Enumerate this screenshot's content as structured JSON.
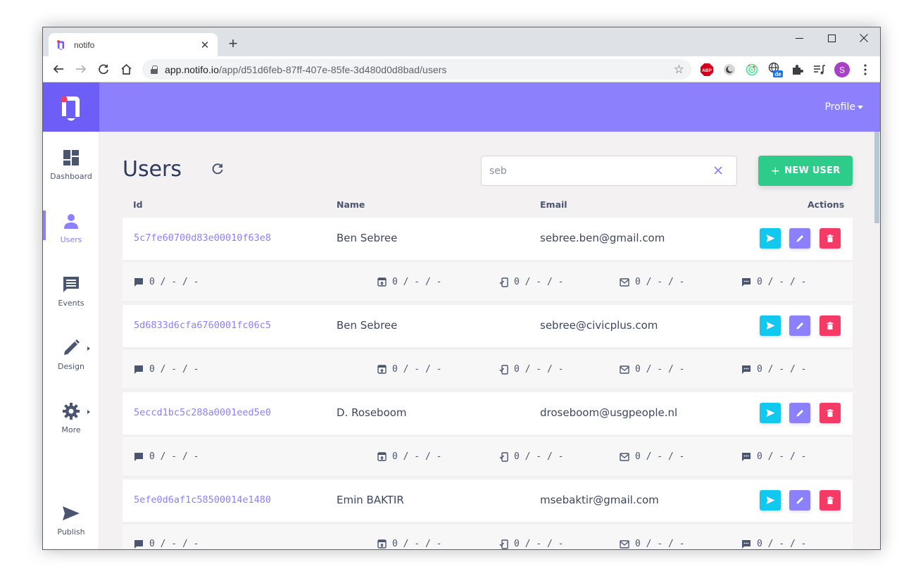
{
  "browser": {
    "tab_title": "notifo",
    "url_host": "app.notifo.io",
    "url_path": "/app/d51d6feb-87ff-407e-85fe-3d480d0d8bad/users",
    "profile_initial": "S",
    "extensions": [
      "adblock-plus-icon",
      "dark-reader-icon",
      "target-extension-icon",
      "translate-de-icon",
      "extensions-puzzle-icon",
      "media-queue-icon"
    ],
    "translate_badge": "de"
  },
  "header": {
    "profile_label": "Profile"
  },
  "sidebar": {
    "items": [
      {
        "label": "Dashboard",
        "icon": "dashboard-icon",
        "active": false
      },
      {
        "label": "Users",
        "icon": "user-icon",
        "active": true
      },
      {
        "label": "Events",
        "icon": "chat-icon",
        "active": false
      },
      {
        "label": "Design",
        "icon": "pencil-icon",
        "active": false,
        "submenu": true
      },
      {
        "label": "More",
        "icon": "gear-icon",
        "active": false,
        "submenu": true
      },
      {
        "label": "Publish",
        "icon": "send-icon",
        "active": false
      }
    ]
  },
  "page": {
    "title": "Users",
    "search_value": "seb",
    "new_user_label": "NEW USER"
  },
  "table": {
    "columns": [
      "Id",
      "Name",
      "Email",
      "Actions"
    ],
    "channel_icons": [
      "web-push-icon",
      "mobile-push-icon",
      "mobile-check-icon",
      "email-icon",
      "sms-icon"
    ],
    "rows": [
      {
        "id": "5c7fe60700d83e00010f63e8",
        "name": "Ben Sebree",
        "email": "sebree.ben@gmail.com",
        "stats": [
          "0 / - / -",
          "0 / - / -",
          "0 / - / -",
          "0 / - / -",
          "0 / - / -"
        ]
      },
      {
        "id": "5d6833d6cfa6760001fc06c5",
        "name": "Ben Sebree",
        "email": "sebree@civicplus.com",
        "stats": [
          "0 / - / -",
          "0 / - / -",
          "0 / - / -",
          "0 / - / -",
          "0 / - / -"
        ]
      },
      {
        "id": "5eccd1bc5c288a0001eed5e0",
        "name": "D. Roseboom",
        "email": "droseboom@usgpeople.nl",
        "stats": [
          "0 / - / -",
          "0 / - / -",
          "0 / - / -",
          "0 / - / -",
          "0 / - / -"
        ]
      },
      {
        "id": "5efe0d6af1c58500014e1480",
        "name": "Emin BAKTIR",
        "email": "msebaktir@gmail.com",
        "stats": [
          "0 / - / -",
          "0 / - / -",
          "0 / - / -",
          "0 / - / -",
          "0 / - / -"
        ]
      }
    ]
  },
  "colors": {
    "brand": "#6e5ef8",
    "header": "#8c80fc",
    "success": "#2ecc8a",
    "info": "#12c8ef",
    "danger": "#f43a65"
  }
}
